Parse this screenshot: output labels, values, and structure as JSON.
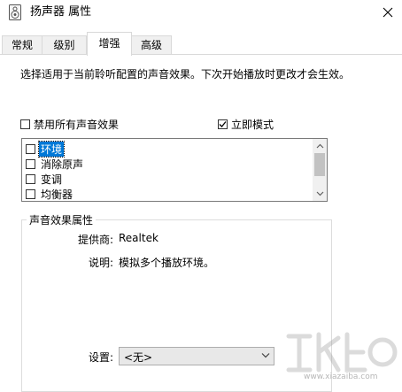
{
  "window": {
    "title": "扬声器 属性",
    "icon": "speaker-icon",
    "close_icon": "close-icon"
  },
  "tabs": [
    {
      "label": "常规",
      "active": false
    },
    {
      "label": "级别",
      "active": false
    },
    {
      "label": "增强",
      "active": true
    },
    {
      "label": "高级",
      "active": false
    }
  ],
  "enhancements": {
    "description": "选择适用于当前聆听配置的声音效果。下次开始播放时更改才会生效。",
    "disable_all": {
      "label": "禁用所有声音效果",
      "checked": false
    },
    "immediate_mode": {
      "label": "立即模式",
      "checked": true
    },
    "effects": [
      {
        "label": "环境",
        "checked": false,
        "selected": true
      },
      {
        "label": "消除原声",
        "checked": false,
        "selected": false
      },
      {
        "label": "变调",
        "checked": false,
        "selected": false
      },
      {
        "label": "均衡器",
        "checked": false,
        "selected": false
      }
    ]
  },
  "properties": {
    "group_title": "声音效果属性",
    "provider_label": "提供商:",
    "provider_value": "Realtek",
    "description_label": "说明:",
    "description_value": "模拟多个播放环境。",
    "settings_label": "设置:",
    "settings_value": "<无>"
  },
  "colors": {
    "selection": "#0078d7",
    "panel_border": "#d9d9d9"
  }
}
